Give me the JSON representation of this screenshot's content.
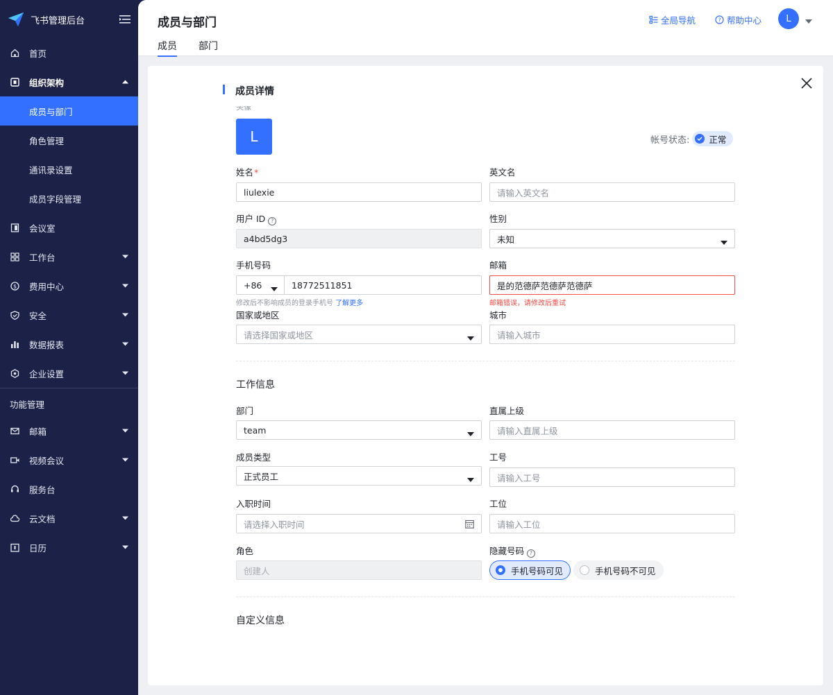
{
  "sidebar": {
    "app_title": "飞书管理后台",
    "items": [
      {
        "label": "首页",
        "icon": "home-icon"
      },
      {
        "label": "组织架构",
        "icon": "org-icon"
      },
      {
        "label": "成员与部门"
      },
      {
        "label": "角色管理"
      },
      {
        "label": "通讯录设置"
      },
      {
        "label": "成员字段管理"
      },
      {
        "label": "会议室",
        "icon": "meeting-room-icon"
      },
      {
        "label": "工作台",
        "icon": "workbench-icon"
      },
      {
        "label": "费用中心",
        "icon": "billing-icon"
      },
      {
        "label": "安全",
        "icon": "shield-icon"
      },
      {
        "label": "数据报表",
        "icon": "chart-icon"
      },
      {
        "label": "企业设置",
        "icon": "settings-icon"
      }
    ],
    "section_label": "功能管理",
    "feature_items": [
      {
        "label": "邮箱",
        "icon": "mail-icon"
      },
      {
        "label": "视频会议",
        "icon": "video-icon"
      },
      {
        "label": "服务台",
        "icon": "headset-icon"
      },
      {
        "label": "云文档",
        "icon": "cloud-doc-icon"
      },
      {
        "label": "日历",
        "icon": "calendar-icon"
      }
    ]
  },
  "header": {
    "title": "成员与部门",
    "tabs": [
      "成员",
      "部门"
    ],
    "global_nav": "全局导航",
    "help_center": "帮助中心",
    "avatar_initial": "L"
  },
  "panel": {
    "title": "成员详情",
    "avatar_label_cut": "头像",
    "avatar_initial": "L",
    "account_status_label": "帐号状态:",
    "account_status_value": "正常",
    "name_label": "姓名",
    "name_required": "*",
    "name_value": "liulexie",
    "english_name_label": "英文名",
    "english_name_placeholder": "请输入英文名",
    "user_id_label": "用户 ID",
    "user_id_value": "a4bd5dg3",
    "gender_label": "性别",
    "gender_value": "未知",
    "phone_label": "手机号码",
    "phone_code": "+86",
    "phone_value": "18772511851",
    "phone_hint": "修改后不影响成员的登录手机号",
    "phone_hint_link": "了解更多",
    "email_label": "邮箱",
    "email_value": "是的范德萨范德萨范德萨",
    "email_error": "邮箱错误，请修改后重试",
    "country_label": "国家或地区",
    "country_placeholder": "请选择国家或地区",
    "city_label": "城市",
    "city_placeholder": "请输入城市",
    "work_section_title": "工作信息",
    "department_label": "部门",
    "department_value": "team",
    "manager_label": "直属上级",
    "manager_placeholder": "请输入直属上级",
    "member_type_label": "成员类型",
    "member_type_value": "正式员工",
    "employee_no_label": "工号",
    "employee_no_placeholder": "请输入工号",
    "join_date_label": "入职时间",
    "join_date_placeholder": "请选择入职时间",
    "workstation_label": "工位",
    "workstation_placeholder": "请输入工位",
    "role_label": "角色",
    "role_placeholder": "创建人",
    "hide_phone_label": "隐藏号码",
    "phone_visible_option": "手机号码可见",
    "phone_hidden_option": "手机号码不可见",
    "custom_section_title": "自定义信息"
  },
  "colors": {
    "sidebar_bg": "#1b2147",
    "accent": "#3370ff",
    "error": "#f54a45"
  }
}
